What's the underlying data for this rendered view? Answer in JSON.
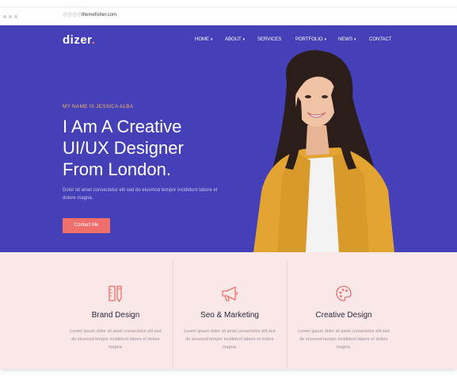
{
  "browser": {
    "url_prefix": "@@@@ |",
    "url": "themefisher.com"
  },
  "header": {
    "logo": "dizer",
    "logo_dot": ".",
    "nav": [
      {
        "label": "HOME",
        "dropdown": true
      },
      {
        "label": "ABOUT",
        "dropdown": true
      },
      {
        "label": "SERVICES",
        "dropdown": false
      },
      {
        "label": "PORTFOLIO",
        "dropdown": true
      },
      {
        "label": "NEWS",
        "dropdown": true
      },
      {
        "label": "CONTACT",
        "dropdown": false
      }
    ]
  },
  "hero": {
    "eyebrow": "MY NAME IS JESSICA ALBA",
    "headline_lines": [
      "I Am A Creative",
      "UI/UX Designer",
      "From London."
    ],
    "description": "Dolor sit amet consectetur elit sed do eiusmod tempor incididunt labore et dolore magna.",
    "cta_label": "Contact Me"
  },
  "services": [
    {
      "icon": "ruler-pencil-icon",
      "title": "Brand Design",
      "text": "Lorem ipsum dolor sit amet consectetur elit sed do eiusmod tempor incididunt labore et dolore magna."
    },
    {
      "icon": "megaphone-icon",
      "title": "Seo & Marketing",
      "text": "Lorem ipsum dolor sit amet consectetur elit sed do eiusmod tempor incididunt labore et dolore magna."
    },
    {
      "icon": "palette-icon",
      "title": "Creative Design",
      "text": "Lorem ipsum dolor sit amet consectetur elit sed do eiusmod tempor incididunt labore et dolore magna."
    }
  ],
  "colors": {
    "hero_bg": "#4540b7",
    "accent": "#ef6f6c",
    "eyebrow": "#f4b35f",
    "services_bg": "#fae7e8"
  }
}
